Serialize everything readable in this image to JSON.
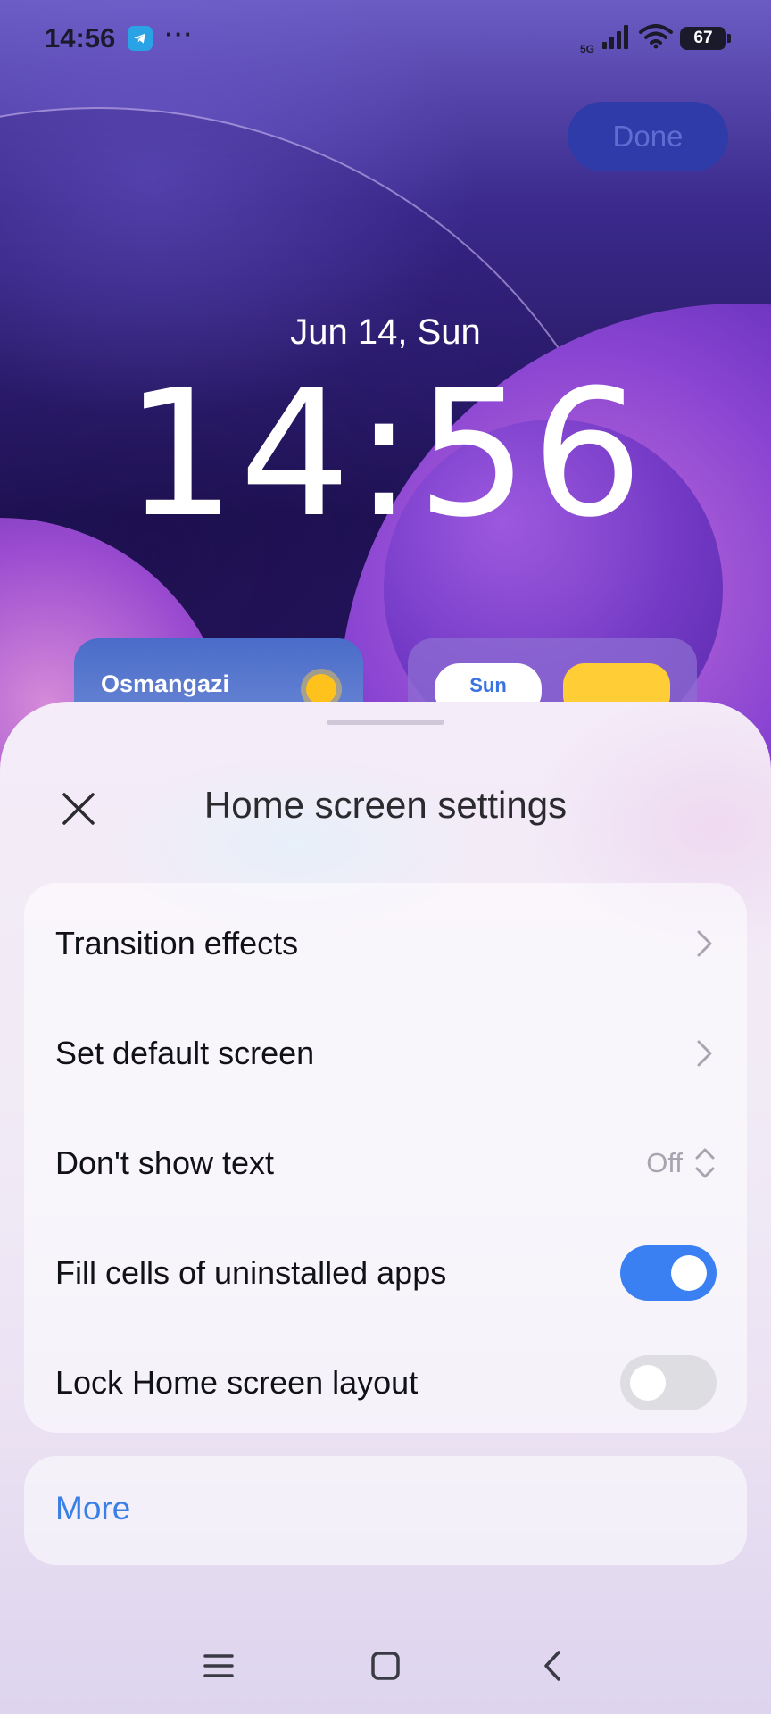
{
  "status_bar": {
    "time": "14:56",
    "network": "5G",
    "battery": "67",
    "notification_icons": [
      "telegram-icon",
      "more-dots-icon"
    ],
    "system_icons": [
      "signal-icon",
      "wifi-icon",
      "battery-icon"
    ]
  },
  "header": {
    "done_label": "Done"
  },
  "lock_screen": {
    "date": "Jun 14, Sun",
    "time": "14:56"
  },
  "widgets": {
    "weather": {
      "location": "Osmangazi",
      "icon": "sun-icon"
    },
    "calendar": {
      "day": "Sun"
    }
  },
  "sheet": {
    "title": "Home screen settings",
    "rows": [
      {
        "label": "Transition effects",
        "control": "chevron"
      },
      {
        "label": "Set default screen",
        "control": "chevron"
      },
      {
        "label": "Don't show text",
        "control": "select",
        "value": "Off"
      },
      {
        "label": "Fill cells of uninstalled apps",
        "control": "toggle",
        "checked": true
      },
      {
        "label": "Lock Home screen layout",
        "control": "toggle",
        "checked": false
      }
    ],
    "more_label": "More"
  },
  "nav_bar": {
    "items": [
      "menu-icon",
      "home-icon",
      "back-icon"
    ]
  },
  "colors": {
    "accent": "#3a80f2",
    "link": "#3a7fe6",
    "done_button_bg": "#2f3ba8"
  }
}
